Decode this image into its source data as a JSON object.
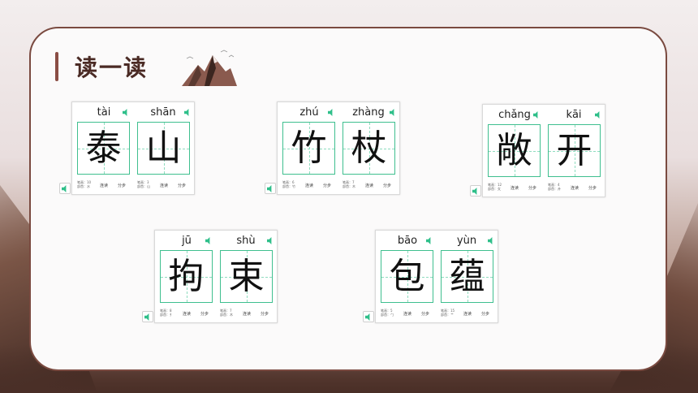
{
  "title": "读一读",
  "cards": [
    {
      "chars": [
        {
          "pinyin": "tài",
          "char": "泰",
          "s1": "笔画：10",
          "s2": "部首：水"
        },
        {
          "pinyin": "shān",
          "char": "山",
          "s1": "笔画：3",
          "s2": "部首：山"
        }
      ]
    },
    {
      "chars": [
        {
          "pinyin": "zhú",
          "char": "竹",
          "s1": "笔画：6",
          "s2": "部首：竹"
        },
        {
          "pinyin": "zhàng",
          "char": "杖",
          "s1": "笔画：7",
          "s2": "部首：木"
        }
      ]
    },
    {
      "chars": [
        {
          "pinyin": "chǎng",
          "char": "敞",
          "s1": "笔画：12",
          "s2": "部首：攵"
        },
        {
          "pinyin": "kāi",
          "char": "开",
          "s1": "笔画：4",
          "s2": "部首：廾"
        }
      ]
    },
    {
      "chars": [
        {
          "pinyin": "jū",
          "char": "拘",
          "s1": "笔画：8",
          "s2": "部首：扌"
        },
        {
          "pinyin": "shù",
          "char": "束",
          "s1": "笔画：7",
          "s2": "部首：木"
        }
      ]
    },
    {
      "chars": [
        {
          "pinyin": "bāo",
          "char": "包",
          "s1": "笔画：5",
          "s2": "部首：勹"
        },
        {
          "pinyin": "yùn",
          "char": "蕴",
          "s1": "笔画：15",
          "s2": "部首：艹"
        }
      ]
    }
  ],
  "buttons": {
    "continuous": "连读",
    "step": "分步"
  },
  "icons": {
    "speaker": "speaker-icon",
    "peak": "mountain-icon"
  },
  "colors": {
    "grid": "#3fbf8f",
    "accent": "#8a4d44",
    "speaker": "#2fbf8a"
  }
}
